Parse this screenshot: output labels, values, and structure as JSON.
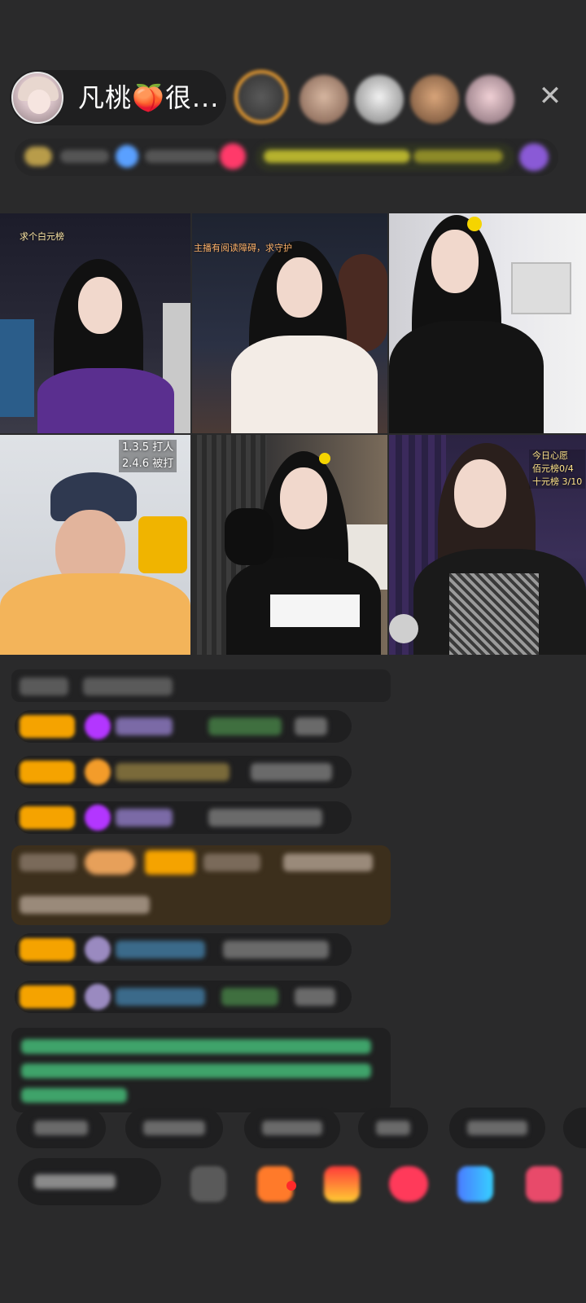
{
  "header": {
    "host_name": "凡桃🍑很...",
    "close_icon": "close-icon",
    "close_glyph": "✕"
  },
  "tiles": [
    {
      "id": "tile-1",
      "overlay": "求个白元榜"
    },
    {
      "id": "tile-2",
      "overlay": "主播有阅读障碍，求守护"
    },
    {
      "id": "tile-3",
      "overlay": ""
    },
    {
      "id": "tile-4",
      "overlay_lines": [
        "1.3.5 打人",
        "2.4.6 被打"
      ]
    },
    {
      "id": "tile-5",
      "overlay": ""
    },
    {
      "id": "tile-6",
      "overlay_lines": [
        "今日心愿",
        "佰元榜0/4",
        "十元榜 3/10"
      ]
    }
  ],
  "colors": {
    "background": "#2a2a2b",
    "pill": "#1f1f20",
    "level_badge": "#f5a300",
    "notice_text": "#3fa36a"
  }
}
